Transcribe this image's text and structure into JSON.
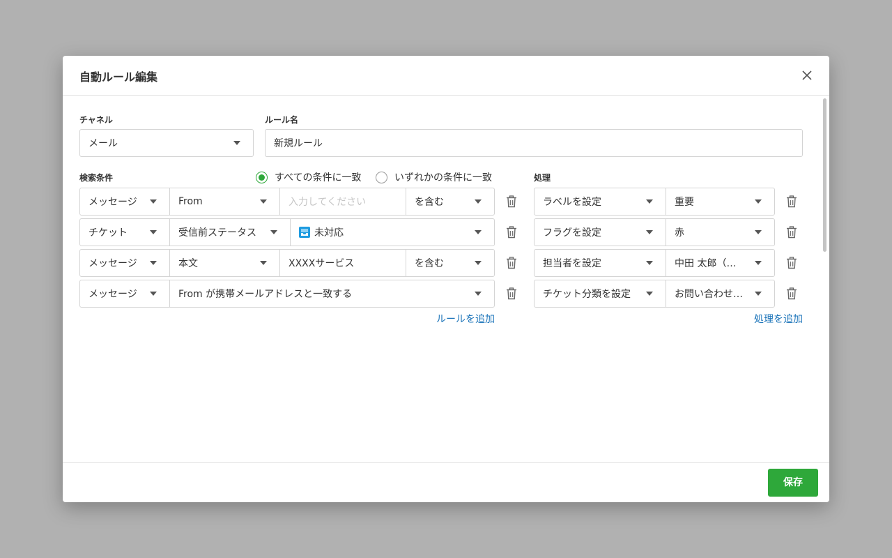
{
  "dialog": {
    "title": "自動ルール編集",
    "save_label": "保存"
  },
  "channel": {
    "label": "チャネル",
    "value": "メール"
  },
  "rule_name": {
    "label": "ルール名",
    "value": "新規ルール"
  },
  "conditions": {
    "label": "検索条件",
    "match_all_label": "すべての条件に一致",
    "match_any_label": "いずれかの条件に一致",
    "match_mode": "all",
    "add_label": "ルールを追加",
    "rows": [
      {
        "target": "メッセージ",
        "field": "From",
        "value_placeholder": "入力してください",
        "value": "",
        "operator": "を含む"
      },
      {
        "target": "チケット",
        "field": "受信前ステータス",
        "status_value": "未対応"
      },
      {
        "target": "メッセージ",
        "field": "本文",
        "value": "XXXXサービス",
        "operator": "を含む"
      },
      {
        "target": "メッセージ",
        "field": "From が携帯メールアドレスと一致する"
      }
    ]
  },
  "actions": {
    "label": "処理",
    "add_label": "処理を追加",
    "rows": [
      {
        "action": "ラベルを設定",
        "value": "重要"
      },
      {
        "action": "フラグを設定",
        "value": "赤"
      },
      {
        "action": "担当者を設定",
        "value": "中田 太郎（…"
      },
      {
        "action": "チケット分類を設定",
        "value": "お問い合わせ…"
      }
    ]
  },
  "icons": {
    "close": "close-icon",
    "trash": "trash-icon",
    "dropdown": "caret-down-icon",
    "status": "inbox-status-icon"
  },
  "colors": {
    "primary_green": "#2ea83a",
    "link_blue": "#1a73b9",
    "status_blue": "#1e9be0",
    "overlay": "#b1b1b1"
  }
}
